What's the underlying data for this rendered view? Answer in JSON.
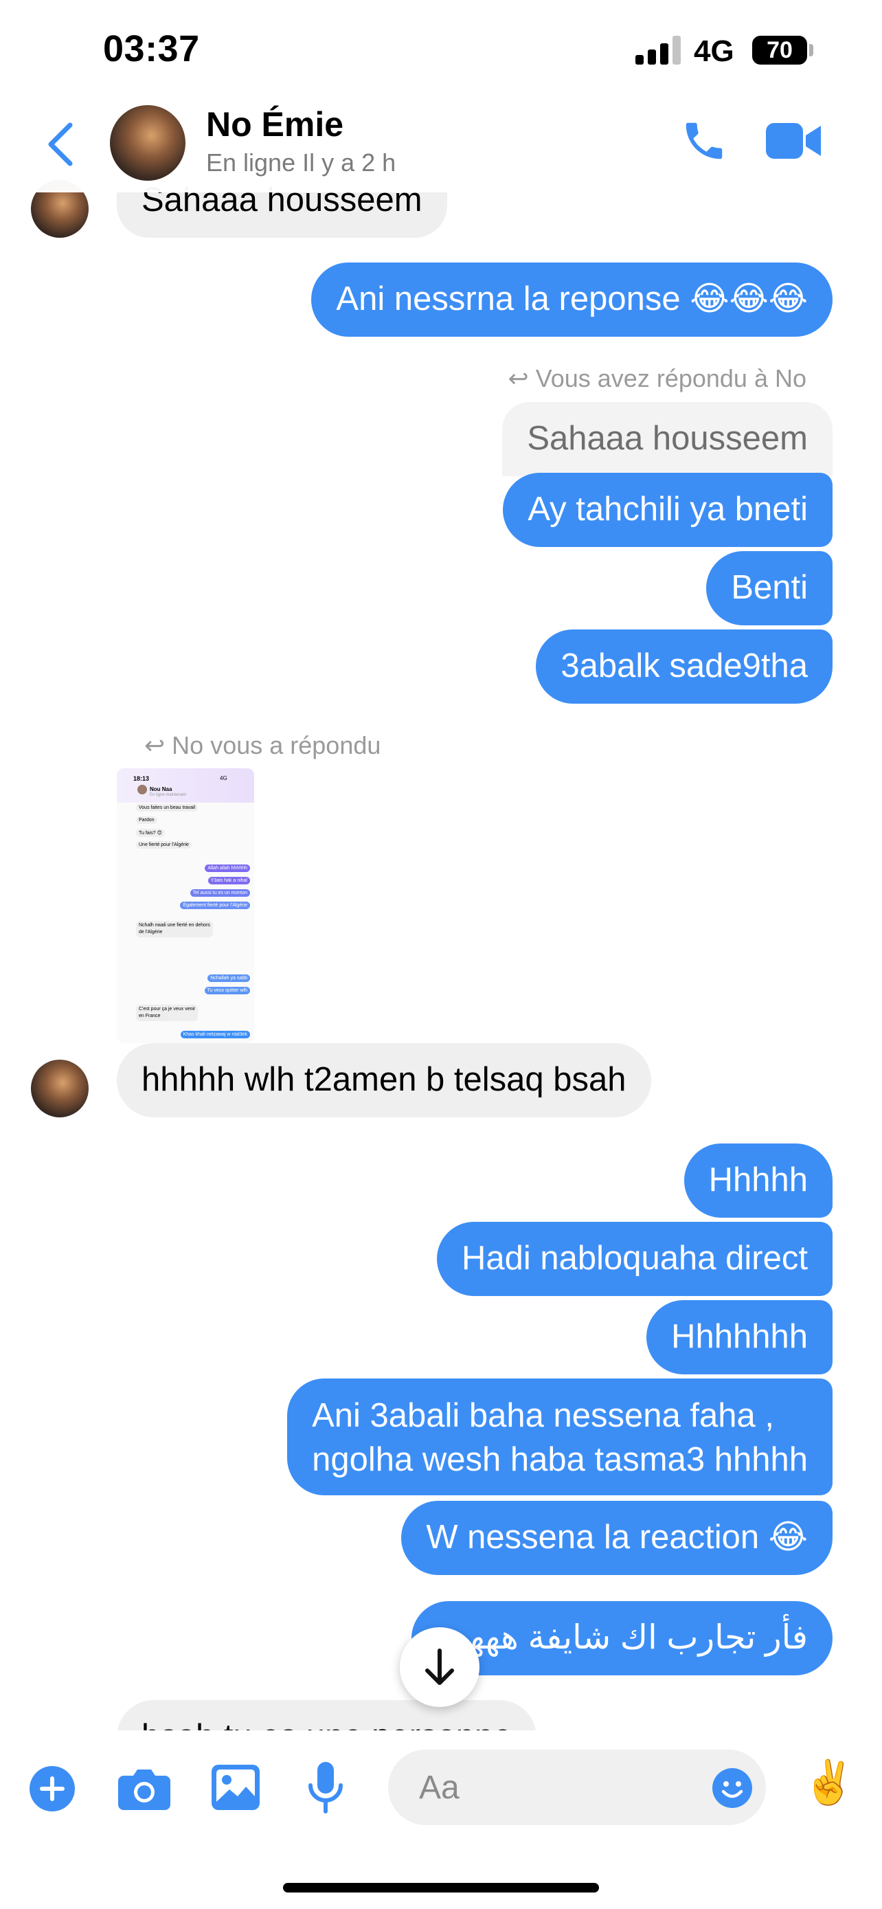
{
  "status_bar": {
    "time": "03:37",
    "network": "4G",
    "battery": "70"
  },
  "header": {
    "name": "No Émie",
    "status": "En ligne Il y a 2 h"
  },
  "messages": {
    "m1": "Sahaaa housseem",
    "m2": "Ani nessrna la reponse 😂😂😂",
    "reply_note_out": "Vous avez répondu à No",
    "quoted": "Sahaaa housseem",
    "m3": "Ay tahchili ya bneti",
    "m4": "Benti",
    "m5": "3abalk sade9tha",
    "reply_note_in": "No vous a répondu",
    "m6": "hhhhh wlh t2amen b telsaq bsah",
    "m7": "Hhhhh",
    "m8": "Hadi nabloquaha direct",
    "m9": "Hhhhhhh",
    "m10_line1": "Ani 3abali baha nessena faha ,",
    "m10_line2": "ngolha wesh haba tasma3 hhhhh",
    "m11": "W nessena la reaction 😂",
    "m12": "فأر تجارب اك شايفة ههههه",
    "m13": "bsah tu es une personne"
  },
  "attachment": {
    "time": "18:13",
    "network": "4G",
    "name": "Nou Naa",
    "status": "En ligne maintenant",
    "lines_in": [
      "Vous faites un beau travail",
      "Pardon",
      "Tu fais? 😊",
      "Une fierté pour l'Algérie"
    ],
    "lines_out": [
      "Allah allah hhhhhh",
      "Y3ais hak a nihal",
      "Tel aussi tu es un monton",
      "Également fierté pour l'Algérie"
    ],
    "lines_in2": [
      "Nchalh nwali une fierté en dehors",
      "de l'Algérie"
    ],
    "lines_out2": [
      "Nchallah ya sabb",
      "Tu veux quitter wlh"
    ],
    "lines_in3": [
      "C'est pour ça je veux venir",
      "en France"
    ],
    "lines_out3": [
      "Khas khali netzawaj w ntal3ek"
    ]
  },
  "composer": {
    "placeholder": "Aa"
  },
  "colors": {
    "accent": "#3c8ef5",
    "incoming_bubble": "#efefef",
    "outgoing_bubble": "#3c8ef5"
  },
  "icons": [
    "back-chevron-icon",
    "phone-icon",
    "video-camera-icon",
    "reply-arrow-icon",
    "arrow-down-icon",
    "plus-icon",
    "camera-icon",
    "image-icon",
    "microphone-icon",
    "emoji-icon",
    "victory-hand-emoji"
  ]
}
